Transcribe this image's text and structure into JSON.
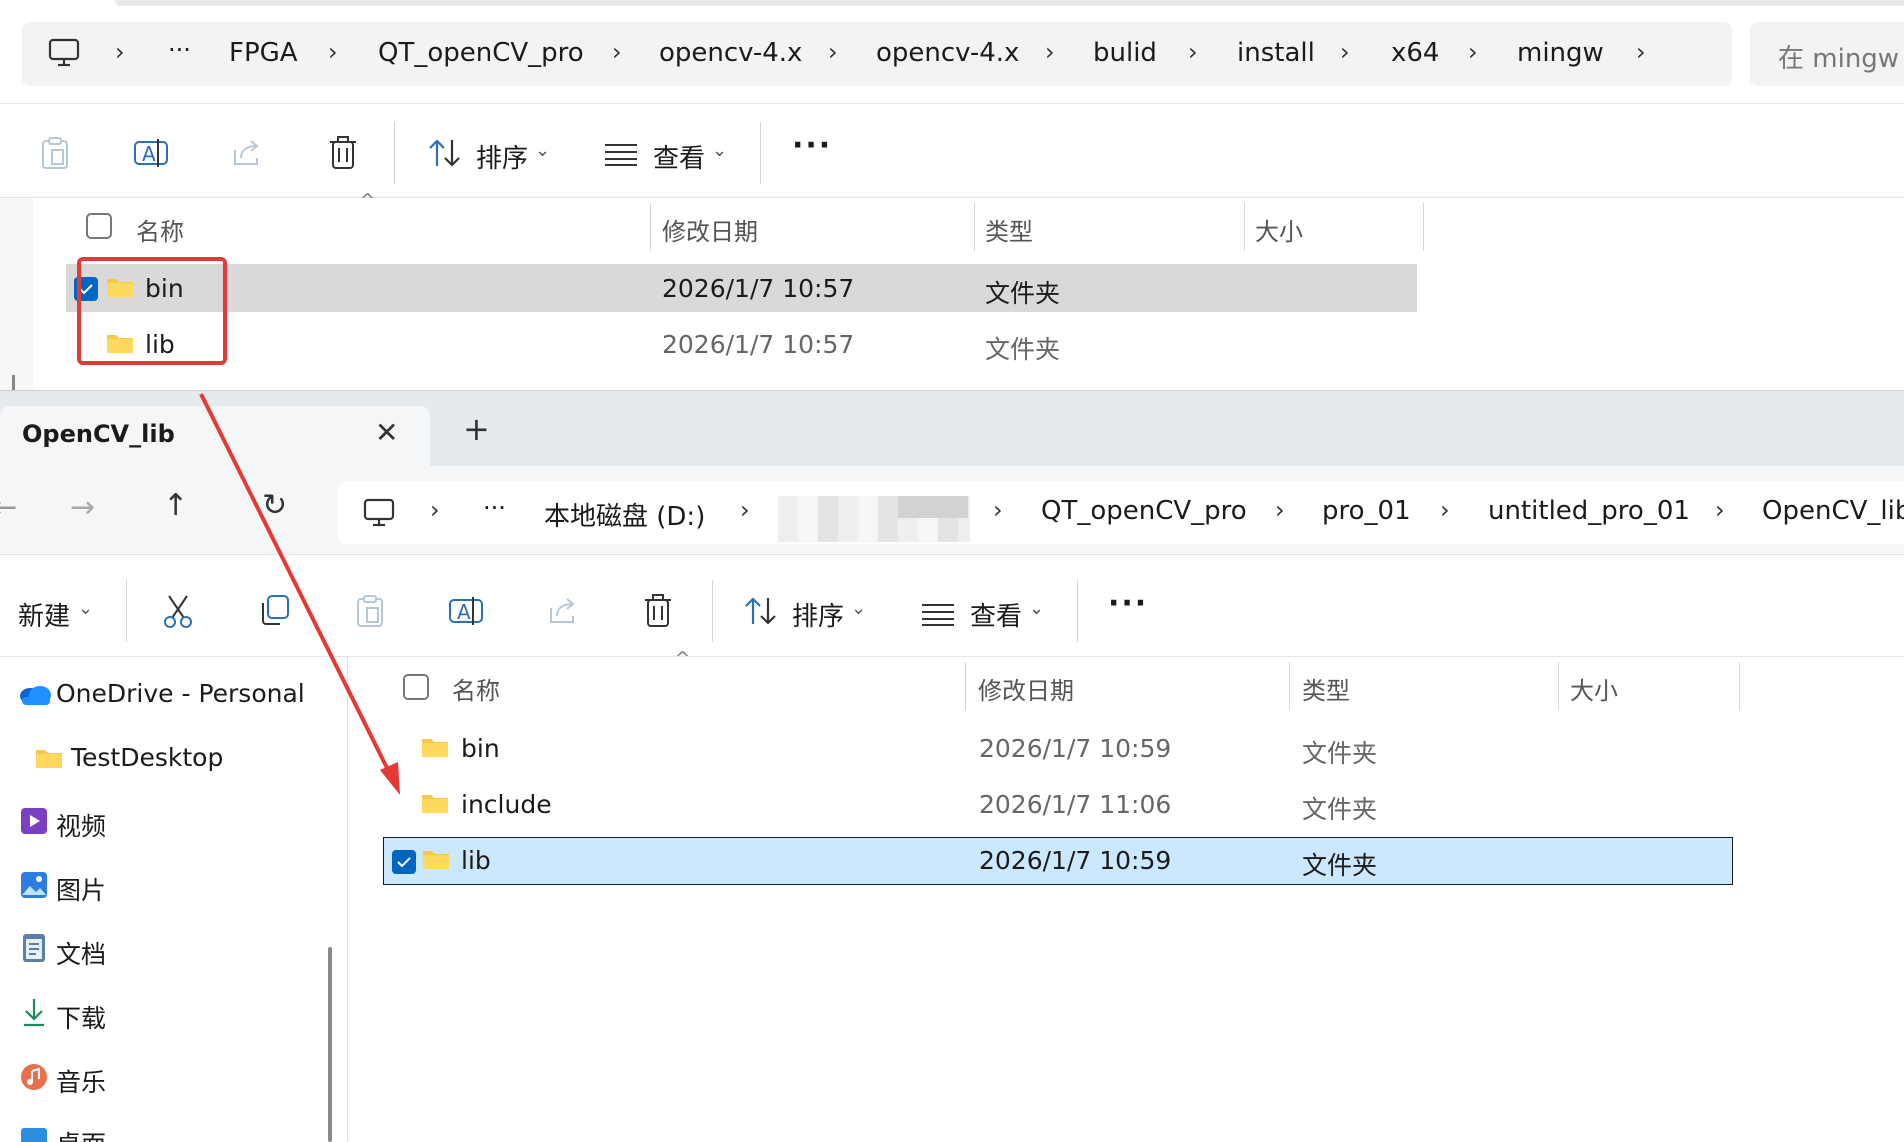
{
  "top_window": {
    "breadcrumbs": [
      "FPGA",
      "QT_openCV_pro",
      "opencv-4.x",
      "opencv-4.x",
      "bulid",
      "install",
      "x64",
      "mingw"
    ],
    "search_placeholder": "在 mingw",
    "toolbar": {
      "sort_label": "排序",
      "view_label": "查看"
    },
    "columns": {
      "name": "名称",
      "date": "修改日期",
      "type": "类型",
      "size": "大小"
    },
    "rows": [
      {
        "name": "bin",
        "date": "2026/1/7 10:57",
        "type": "文件夹",
        "selected": true
      },
      {
        "name": "lib",
        "date": "2026/1/7 10:57",
        "type": "文件夹",
        "selected": false
      }
    ]
  },
  "bottom_window": {
    "tab_title": "OpenCV_lib",
    "breadcrumbs": [
      "本地磁盘 (D:)",
      "QT_openCV_pro",
      "pro_01",
      "untitled_pro_01",
      "OpenCV_lib"
    ],
    "toolbar": {
      "new_label": "新建",
      "sort_label": "排序",
      "view_label": "查看"
    },
    "sidebar": [
      {
        "label": "OneDrive - Personal",
        "icon": "onedrive-icon"
      },
      {
        "label": "TestDesktop",
        "icon": "folder-icon"
      },
      {
        "label": "视频",
        "icon": "video-icon"
      },
      {
        "label": "图片",
        "icon": "pictures-icon"
      },
      {
        "label": "文档",
        "icon": "documents-icon"
      },
      {
        "label": "下载",
        "icon": "download-icon"
      },
      {
        "label": "音乐",
        "icon": "music-icon"
      },
      {
        "label": "桌面",
        "icon": "desktop-icon"
      }
    ],
    "columns": {
      "name": "名称",
      "date": "修改日期",
      "type": "类型",
      "size": "大小"
    },
    "rows": [
      {
        "name": "bin",
        "date": "2026/1/7 10:59",
        "type": "文件夹",
        "selected": false
      },
      {
        "name": "include",
        "date": "2026/1/7 11:06",
        "type": "文件夹",
        "selected": false
      },
      {
        "name": "lib",
        "date": "2026/1/7 10:59",
        "type": "文件夹",
        "selected": true
      }
    ]
  },
  "colors": {
    "annotation_red": "#e53935",
    "selection_blue": "#cce8ff",
    "checkbox_blue": "#0067c0",
    "folder_yellow": "#f7c948"
  }
}
